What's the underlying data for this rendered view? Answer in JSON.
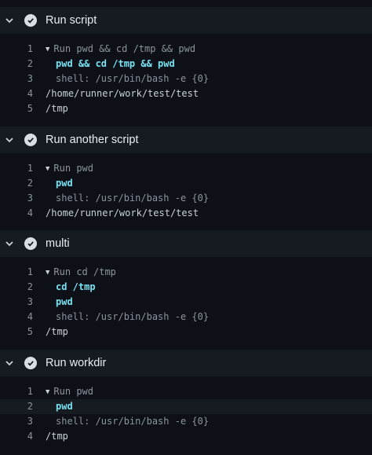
{
  "colors": {
    "background": "#0d1117",
    "header_background": "#161b22",
    "command_text": "#79e2f2",
    "line_number": "#8b949e",
    "check_circle": "#d8dee4"
  },
  "steps": [
    {
      "title": "Run script",
      "lines": [
        {
          "n": "1",
          "text": "Run pwd && cd /tmp && pwd"
        },
        {
          "n": "2",
          "text": "pwd && cd /tmp && pwd"
        },
        {
          "n": "3",
          "text": "shell: /usr/bin/bash -e {0}"
        },
        {
          "n": "4",
          "text": "/home/runner/work/test/test"
        },
        {
          "n": "5",
          "text": "/tmp"
        }
      ]
    },
    {
      "title": "Run another script",
      "lines": [
        {
          "n": "1",
          "text": "Run pwd"
        },
        {
          "n": "2",
          "text": "pwd"
        },
        {
          "n": "3",
          "text": "shell: /usr/bin/bash -e {0}"
        },
        {
          "n": "4",
          "text": "/home/runner/work/test/test"
        }
      ]
    },
    {
      "title": "multi",
      "lines": [
        {
          "n": "1",
          "text": "Run cd /tmp"
        },
        {
          "n": "2",
          "text": "cd /tmp"
        },
        {
          "n": "3",
          "text": "pwd"
        },
        {
          "n": "4",
          "text": "shell: /usr/bin/bash -e {0}"
        },
        {
          "n": "5",
          "text": "/tmp"
        }
      ]
    },
    {
      "title": "Run workdir",
      "lines": [
        {
          "n": "1",
          "text": "Run pwd"
        },
        {
          "n": "2",
          "text": "pwd"
        },
        {
          "n": "3",
          "text": "shell: /usr/bin/bash -e {0}"
        },
        {
          "n": "4",
          "text": "/tmp"
        }
      ]
    }
  ]
}
